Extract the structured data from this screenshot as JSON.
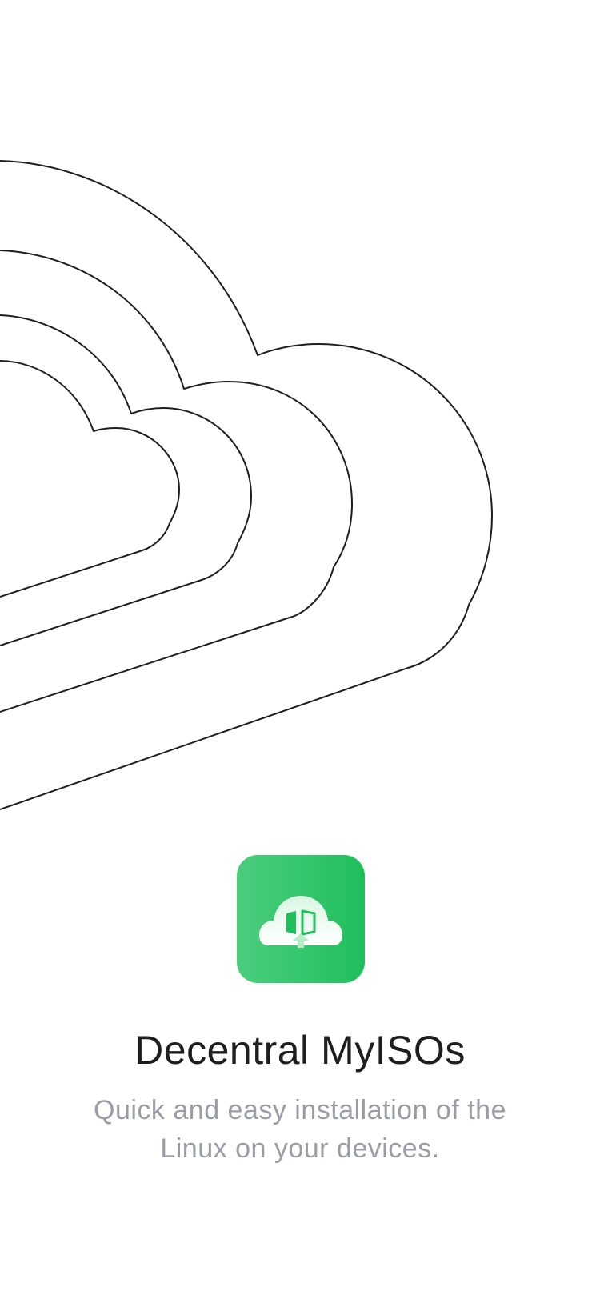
{
  "app": {
    "name": "Decentral MyISOs",
    "tagline": "Quick and easy installation of the Linux on your devices.",
    "icon": "cloud-upload-icon"
  },
  "colors": {
    "brand_green_light": "#4ccd7e",
    "brand_green": "#1fbf5c",
    "title_text": "#1e1e1e",
    "subtitle_text": "#9a9da6",
    "outline": "#1e1e1e"
  },
  "illustration": {
    "icon": "nested-clouds-illustration"
  }
}
